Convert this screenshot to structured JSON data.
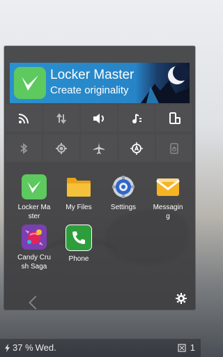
{
  "banner": {
    "title": "Locker Master",
    "subtitle": "Create originality"
  },
  "toggles": [
    {
      "icon": "wifi-icon"
    },
    {
      "icon": "data-transfer-icon"
    },
    {
      "icon": "volume-icon"
    },
    {
      "icon": "ringtone-icon"
    },
    {
      "icon": "rotate-phone-icon"
    },
    {
      "icon": "bluetooth-icon"
    },
    {
      "icon": "gps-icon"
    },
    {
      "icon": "airplane-icon"
    },
    {
      "icon": "auto-brightness-icon"
    },
    {
      "icon": "power-icon"
    }
  ],
  "apps": [
    {
      "label": "Locker Ma\nster",
      "icon": "locker-master-icon",
      "color": "#5dc95f"
    },
    {
      "label": "My Files",
      "icon": "folder-icon",
      "color": "#f3b321"
    },
    {
      "label": "Settings",
      "icon": "settings-gear-icon",
      "color": "#2f67c9"
    },
    {
      "label": "Messagin\ng",
      "icon": "message-icon",
      "color": "#f5b423"
    },
    {
      "label": "Candy Cru\nsh Saga",
      "icon": "candy-crush-icon",
      "color": "#c5306c"
    },
    {
      "label": "Phone",
      "icon": "phone-icon",
      "color": "#4caf50"
    }
  ],
  "status": {
    "battery": "37 %",
    "day": "Wed.",
    "notifications": "1"
  }
}
